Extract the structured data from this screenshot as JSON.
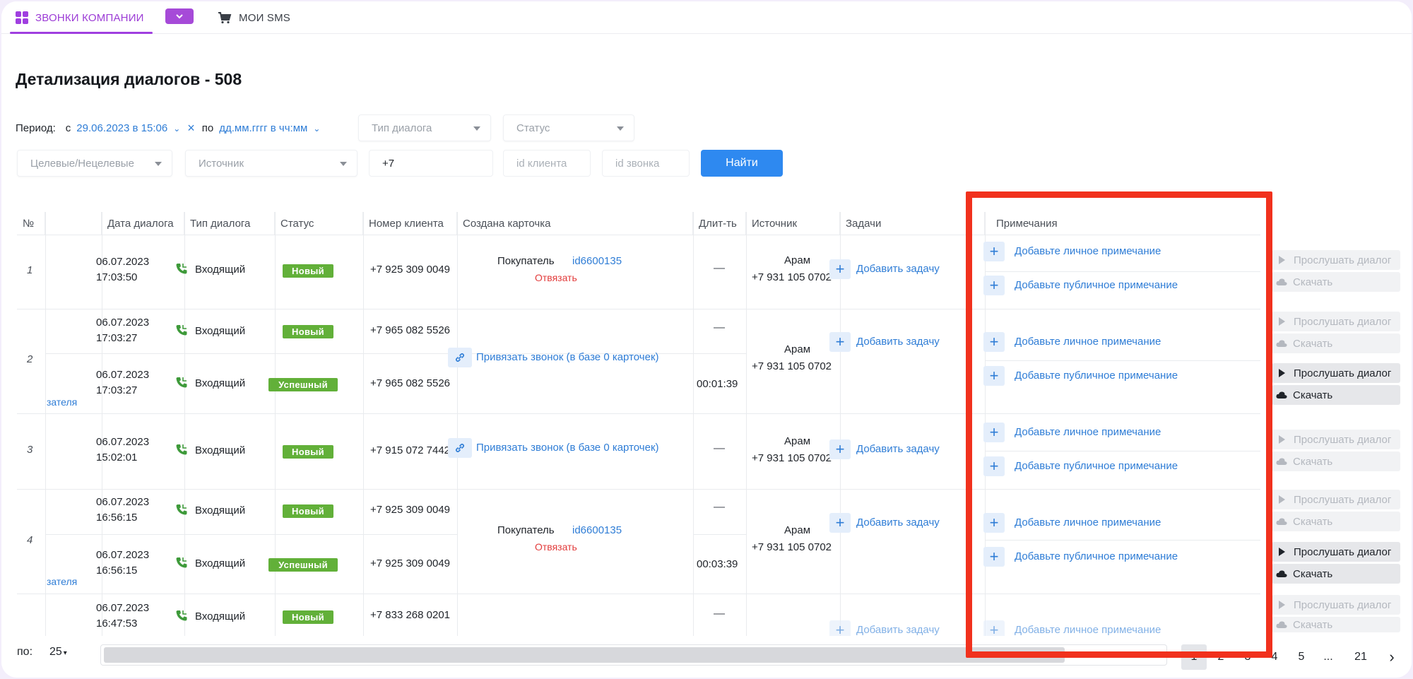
{
  "tabs": {
    "calls_label": "ЗВОНКИ КОМПАНИИ",
    "sms_label": "МОИ SMS"
  },
  "page_title": "Детализация диалогов - 508",
  "filters": {
    "period_label": "Период:",
    "from_prefix": "с",
    "from_value": "29.06.2023 в 15:06",
    "to_prefix": "по",
    "to_value": "дд.мм.гггг в чч:мм",
    "dialog_type_placeholder": "Тип диалога",
    "status_placeholder": "Статус",
    "target_placeholder": "Целевые/Нецелевые",
    "source_placeholder": "Источник",
    "phone_value": "+7",
    "client_id_placeholder": "id клиента",
    "call_id_placeholder": "id звонка",
    "find_label": "Найти"
  },
  "table": {
    "headers": {
      "num": "№",
      "date": "Дата диалога",
      "type": "Тип диалога",
      "status": "Статус",
      "client_phone": "Номер клиента",
      "card": "Создана карточка",
      "duration": "Длит-ть",
      "source": "Источник",
      "tasks": "Задачи",
      "notes": "Примечания"
    },
    "rows": [
      {
        "num": "1",
        "date": "06.07.2023",
        "time": "17:03:50",
        "type": "Входящий",
        "status": "Новый",
        "phone": "+7 925 309 0049",
        "duration": "—"
      },
      {
        "num": "2",
        "date": "06.07.2023",
        "time": "17:03:27",
        "type": "Входящий",
        "status": "Новый",
        "phone": "+7 965 082 5526",
        "duration": "—"
      },
      {
        "date": "06.07.2023",
        "time": "17:03:27",
        "type": "Входящий",
        "status": "Успешный",
        "phone": "+7 965 082 5526",
        "duration": "00:01:39"
      },
      {
        "num": "3",
        "date": "06.07.2023",
        "time": "15:02:01",
        "type": "Входящий",
        "status": "Новый",
        "phone": "+7 915 072 7442",
        "duration": "—"
      },
      {
        "num": "4",
        "date": "06.07.2023",
        "time": "16:56:15",
        "type": "Входящий",
        "status": "Новый",
        "phone": "+7 925 309 0049",
        "duration": "—"
      },
      {
        "date": "06.07.2023",
        "time": "16:56:15",
        "type": "Входящий",
        "status": "Успешный",
        "phone": "+7 925 309 0049",
        "duration": "00:03:39"
      },
      {
        "date": "06.07.2023",
        "time": "16:47:53",
        "type": "Входящий",
        "status": "Новый",
        "phone": "+7 833 268 0201",
        "duration": "—"
      }
    ],
    "left_fragment": "зателя",
    "buyer_label": "Покупатель",
    "buyer_id": "id6600135",
    "unlink_label": "Отвязать",
    "attach_label": "Привязать звонок (в базе 0 карточек)",
    "source_name": "Арам",
    "source_phone": "+7 931 105 0702",
    "add_task_label": "Добавить задачу",
    "add_private_note": "Добавьте личное примечание",
    "add_public_note": "Добавьте публичное примечание",
    "listen_label": "Прослушать диалог",
    "download_label": "Скачать"
  },
  "pagination": {
    "per_label": "по:",
    "per_value": "25",
    "pages": [
      "1",
      "2",
      "3",
      "4",
      "5",
      "...",
      "21"
    ]
  },
  "colors": {
    "accent": "#a03fe0",
    "link": "#2f7dd6",
    "success": "#62b039",
    "highlight": "#f1311d",
    "primary_button": "#2e89f0"
  }
}
